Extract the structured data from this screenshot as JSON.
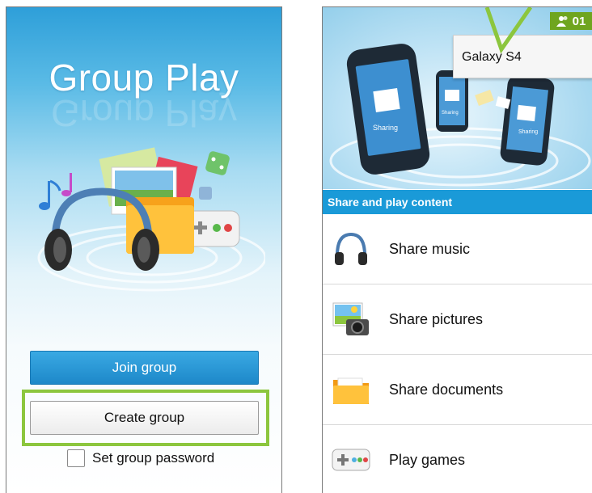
{
  "left": {
    "app_title": "Group Play",
    "join_label": "Join group",
    "create_label": "Create group",
    "password_label": "Set group password",
    "password_checked": false
  },
  "right": {
    "connected_count": "01",
    "device_name": "Galaxy S4",
    "section_header": "Share and play content",
    "banner_sharing_label": "Sharing",
    "menu": [
      {
        "label": "Share music",
        "icon": "headphones-icon"
      },
      {
        "label": "Share pictures",
        "icon": "camera-picture-icon"
      },
      {
        "label": "Share documents",
        "icon": "folder-icon"
      },
      {
        "label": "Play games",
        "icon": "gamepad-icon"
      }
    ]
  },
  "colors": {
    "accent_blue": "#1a9ad8",
    "highlight_green": "#8cc63e",
    "badge_green": "#6fa51f"
  }
}
